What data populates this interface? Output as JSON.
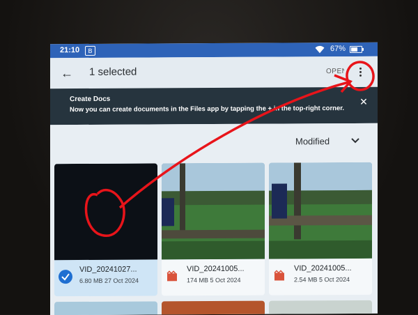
{
  "status_bar": {
    "time": "21:10",
    "notification_badge": "B",
    "battery": "67%",
    "battery_level": 0.67
  },
  "app_bar": {
    "title": "1 selected",
    "open_label": "OPEN",
    "back_icon": "arrow-back-icon",
    "more_icon": "more-vert-icon"
  },
  "banner": {
    "title": "Create Docs",
    "text": "Now you can create documents in the Files app by tapping the + in the top-right corner.",
    "close_icon": "close-icon"
  },
  "sort": {
    "label": "Modified",
    "icon": "chevron-down-icon"
  },
  "files": [
    {
      "name": "VID_20241027...",
      "info": "6.80 MB 27 Oct 2024",
      "selected": true
    },
    {
      "name": "VID_20241005...",
      "info": "174 MB 5 Oct 2024",
      "selected": false
    },
    {
      "name": "VID_20241005...",
      "info": "2.54 MB 5 Oct 2024",
      "selected": false
    }
  ],
  "colors": {
    "status_bar": "#2e63b8",
    "banner": "#26343e",
    "selection": "#cfe5f6",
    "check": "#1f6fd1",
    "video_icon": "#d9533b",
    "annotation": "#e8141a"
  }
}
